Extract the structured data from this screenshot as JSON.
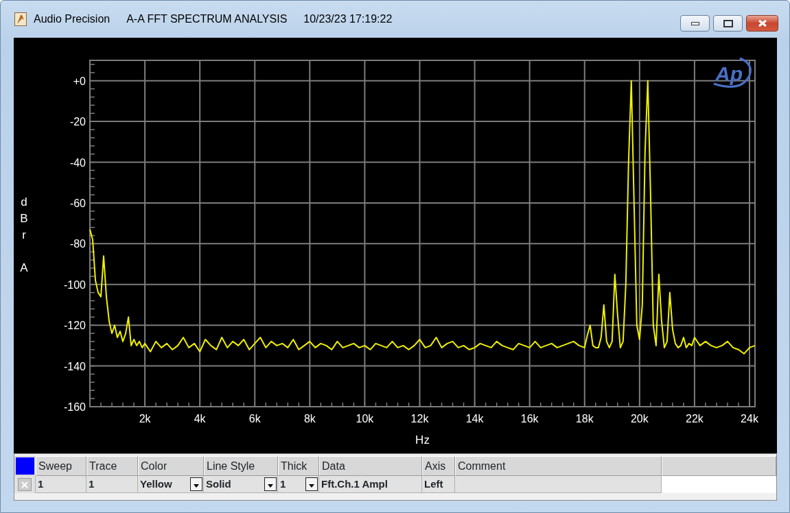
{
  "window": {
    "app": "Audio Precision",
    "title": "A-A FFT SPECTRUM ANALYSIS",
    "timestamp": "10/23/23 17:19:22"
  },
  "plot": {
    "logo": "Ap",
    "chart_data": {
      "type": "line",
      "xlabel": "Hz",
      "ylabel": "dBr A",
      "xlim": [
        0,
        24.2
      ],
      "ylim": [
        -160,
        10
      ],
      "xticks": [
        {
          "value": 2,
          "label": "2k"
        },
        {
          "value": 4,
          "label": "4k"
        },
        {
          "value": 6,
          "label": "6k"
        },
        {
          "value": 8,
          "label": "8k"
        },
        {
          "value": 10,
          "label": "10k"
        },
        {
          "value": 12,
          "label": "12k"
        },
        {
          "value": 14,
          "label": "14k"
        },
        {
          "value": 16,
          "label": "16k"
        },
        {
          "value": 18,
          "label": "18k"
        },
        {
          "value": 20,
          "label": "20k"
        },
        {
          "value": 22,
          "label": "22k"
        },
        {
          "value": 24,
          "label": "24k"
        }
      ],
      "yticks": [
        {
          "value": 0,
          "label": "+0"
        },
        -20,
        -40,
        -60,
        -80,
        -100,
        -120,
        -140,
        -160
      ],
      "x": [
        0,
        0.1,
        0.2,
        0.3,
        0.4,
        0.5,
        0.6,
        0.7,
        0.8,
        0.9,
        1,
        1.1,
        1.2,
        1.3,
        1.4,
        1.5,
        1.6,
        1.7,
        1.8,
        1.9,
        2,
        2.2,
        2.4,
        2.6,
        2.8,
        3,
        3.2,
        3.4,
        3.6,
        3.8,
        4,
        4.2,
        4.4,
        4.6,
        4.8,
        5,
        5.2,
        5.4,
        5.6,
        5.8,
        6,
        6.2,
        6.4,
        6.6,
        6.8,
        7,
        7.2,
        7.4,
        7.6,
        7.8,
        8,
        8.2,
        8.4,
        8.6,
        8.8,
        9,
        9.2,
        9.4,
        9.6,
        9.8,
        10,
        10.2,
        10.4,
        10.6,
        10.8,
        11,
        11.2,
        11.4,
        11.6,
        11.8,
        12,
        12.2,
        12.4,
        12.6,
        12.8,
        13,
        13.2,
        13.4,
        13.6,
        13.8,
        14,
        14.2,
        14.4,
        14.6,
        14.8,
        15,
        15.2,
        15.4,
        15.6,
        15.8,
        16,
        16.2,
        16.4,
        16.6,
        16.8,
        17,
        17.2,
        17.4,
        17.6,
        17.8,
        18,
        18.1,
        18.2,
        18.3,
        18.4,
        18.5,
        18.6,
        18.7,
        18.8,
        18.9,
        19,
        19.1,
        19.2,
        19.3,
        19.4,
        19.5,
        19.6,
        19.7,
        19.8,
        19.9,
        20,
        20.1,
        20.2,
        20.3,
        20.4,
        20.5,
        20.6,
        20.7,
        20.8,
        20.9,
        21,
        21.1,
        21.2,
        21.3,
        21.4,
        21.5,
        21.6,
        21.7,
        21.8,
        21.9,
        22,
        22.2,
        22.4,
        22.6,
        22.8,
        23,
        23.2,
        23.4,
        23.6,
        23.8,
        24,
        24.2
      ],
      "grid": true,
      "series": [
        {
          "color": "#f0f000",
          "values": [
            -73,
            -78,
            -98,
            -104,
            -106,
            -86,
            -106,
            -118,
            -124,
            -120,
            -126,
            -123,
            -128,
            -124,
            -116,
            -130,
            -127,
            -130,
            -128,
            -131,
            -129,
            -133,
            -128,
            -131,
            -129,
            -132,
            -130,
            -126,
            -131,
            -129,
            -133,
            -127,
            -130,
            -132,
            -126,
            -131,
            -128,
            -130,
            -127,
            -132,
            -129,
            -126,
            -131,
            -128,
            -130,
            -129,
            -131,
            -127,
            -132,
            -130,
            -128,
            -131,
            -129,
            -130,
            -132,
            -128,
            -131,
            -130,
            -129,
            -131,
            -130,
            -132,
            -129,
            -130,
            -131,
            -128,
            -131,
            -130,
            -132,
            -130,
            -127,
            -131,
            -130,
            -126,
            -131,
            -129,
            -128,
            -131,
            -130,
            -132,
            -131,
            -129,
            -130,
            -131,
            -128,
            -130,
            -131,
            -132,
            -129,
            -130,
            -131,
            -128,
            -131,
            -130,
            -129,
            -131,
            -130,
            -129,
            -128,
            -130,
            -131,
            -125,
            -120,
            -130,
            -131,
            -131,
            -126,
            -110,
            -128,
            -131,
            -128,
            -95,
            -115,
            -131,
            -128,
            -100,
            -40,
            0,
            -60,
            -120,
            -127,
            -110,
            -35,
            0,
            -55,
            -120,
            -130,
            -95,
            -118,
            -131,
            -128,
            -104,
            -122,
            -129,
            -131,
            -130,
            -126,
            -131,
            -129,
            -130,
            -126,
            -130,
            -128,
            -130,
            -131,
            -130,
            -128,
            -131,
            -132,
            -134,
            -131,
            -130
          ]
        }
      ]
    }
  },
  "trace_table": {
    "columns": [
      "Sweep",
      "Trace",
      "Color",
      "Line Style",
      "Thick",
      "Data",
      "Axis",
      "Comment"
    ],
    "rows": [
      {
        "cells": [
          {
            "kind": "text",
            "text": "1"
          },
          {
            "kind": "text",
            "text": "1"
          },
          {
            "kind": "dropdown",
            "text": "Yellow"
          },
          {
            "kind": "dropdown",
            "text": "Solid"
          },
          {
            "kind": "dropdown",
            "text": "1"
          },
          {
            "kind": "text",
            "text": "Fft.Ch.1 Ampl"
          },
          {
            "kind": "text",
            "text": "Left"
          }
        ]
      }
    ]
  }
}
